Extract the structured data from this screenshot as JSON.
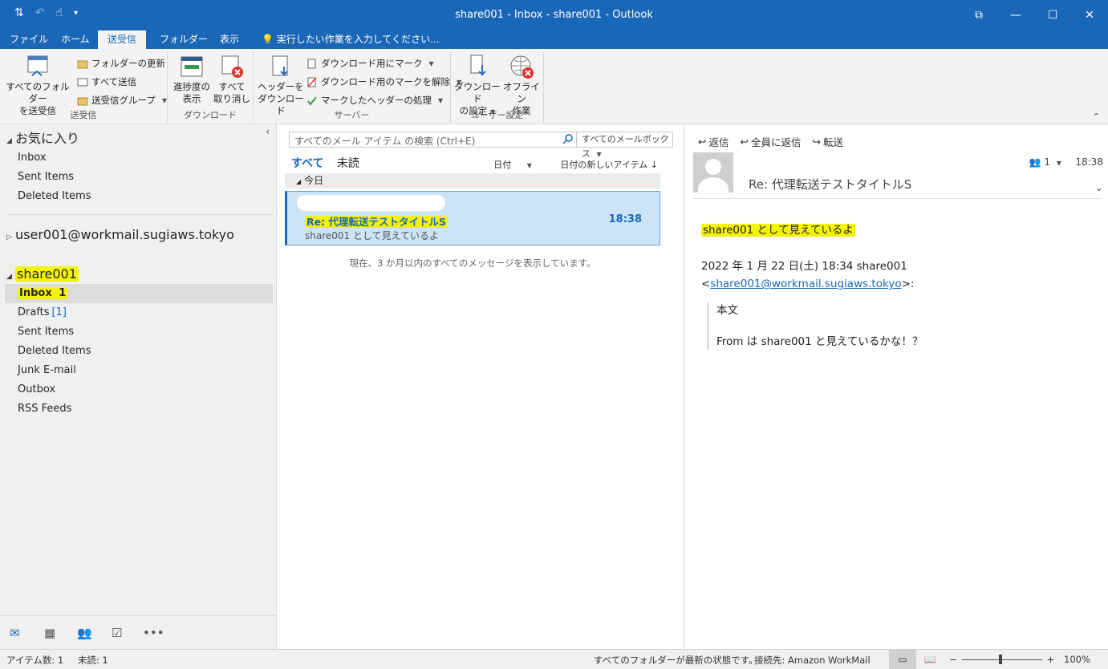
{
  "window": {
    "title": "share001 - Inbox - share001 - Outlook",
    "controls": {
      "restore": "⧉",
      "minimize": "—",
      "maximize": "☐",
      "close": "✕"
    }
  },
  "tabs": [
    {
      "label": "ファイル"
    },
    {
      "label": "ホーム"
    },
    {
      "label": "送受信",
      "active": true
    },
    {
      "label": "フォルダー"
    },
    {
      "label": "表示"
    }
  ],
  "tellme": "実行したい作業を入力してください...",
  "ribbon": {
    "groups": {
      "sendreceive": {
        "label": "送受信",
        "send_receive_all": [
          "すべてのフォルダー",
          "を送受信"
        ],
        "update_folder": "フォルダーの更新",
        "send_all": "すべて送信",
        "send_receive_groups": "送受信グループ"
      },
      "download": {
        "label": "ダウンロード",
        "show_progress": [
          "進捗度の",
          "表示"
        ],
        "cancel_all": [
          "すべて",
          "取り消し"
        ]
      },
      "server": {
        "label": "サーバー",
        "download_headers": [
          "ヘッダーを",
          "ダウンロード"
        ],
        "mark_to_download": "ダウンロード用にマーク",
        "unmark_to_download": "ダウンロード用のマークを解除",
        "process_marked": "マークしたヘッダーの処理"
      },
      "preferences": {
        "label": "ユーザー設定",
        "download_prefs": [
          "ダウンロード",
          "の設定"
        ],
        "work_offline": [
          "オフライン",
          "作業"
        ]
      }
    }
  },
  "folders": {
    "favorites_title": "お気に入り",
    "favorites": [
      "Inbox",
      "Sent Items",
      "Deleted Items"
    ],
    "account1": "user001@workmail.sugiaws.tokyo",
    "account2": "share001",
    "account2_items": [
      {
        "label": "Inbox",
        "count": "1"
      },
      {
        "label": "Drafts",
        "count": "[1]"
      },
      {
        "label": "Sent Items"
      },
      {
        "label": "Deleted Items"
      },
      {
        "label": "Junk E-mail"
      },
      {
        "label": "Outbox"
      },
      {
        "label": "RSS Feeds"
      }
    ]
  },
  "list": {
    "search_placeholder": "すべてのメール アイテム の検索 (Ctrl+E)",
    "search_scope": "すべてのメールボックス",
    "filter_all": "すべて",
    "filter_unread": "未読",
    "sort_by": "日付",
    "sort_order": "日付の新しいアイテム",
    "group_header": "今日",
    "message": {
      "subject": "Re: 代理転送テストタイトルS",
      "time": "18:38",
      "preview": "share001 として見えているよ"
    },
    "note": "現在、3 か月以内のすべてのメッセージを表示しています。"
  },
  "reading": {
    "reply": "返信",
    "reply_all": "全員に返信",
    "forward": "転送",
    "people_count": "1",
    "time": "18:38",
    "subject": "Re: 代理転送テストタイトルS",
    "body_line1": "share001 として見えているよ",
    "quote_header": "2022 年 1 月 22 日(土) 18:34 share001",
    "quote_email": "share001@workmail.sugiaws.tokyo",
    "quote_body1": "本文",
    "quote_body2": "From は share001 と見えているかな！？"
  },
  "status": {
    "items": "アイテム数: 1",
    "unread": "未読: 1",
    "folders_state": "すべてのフォルダーが最新の状態です。",
    "connection": "接続先: Amazon WorkMail",
    "zoom": "100%"
  }
}
